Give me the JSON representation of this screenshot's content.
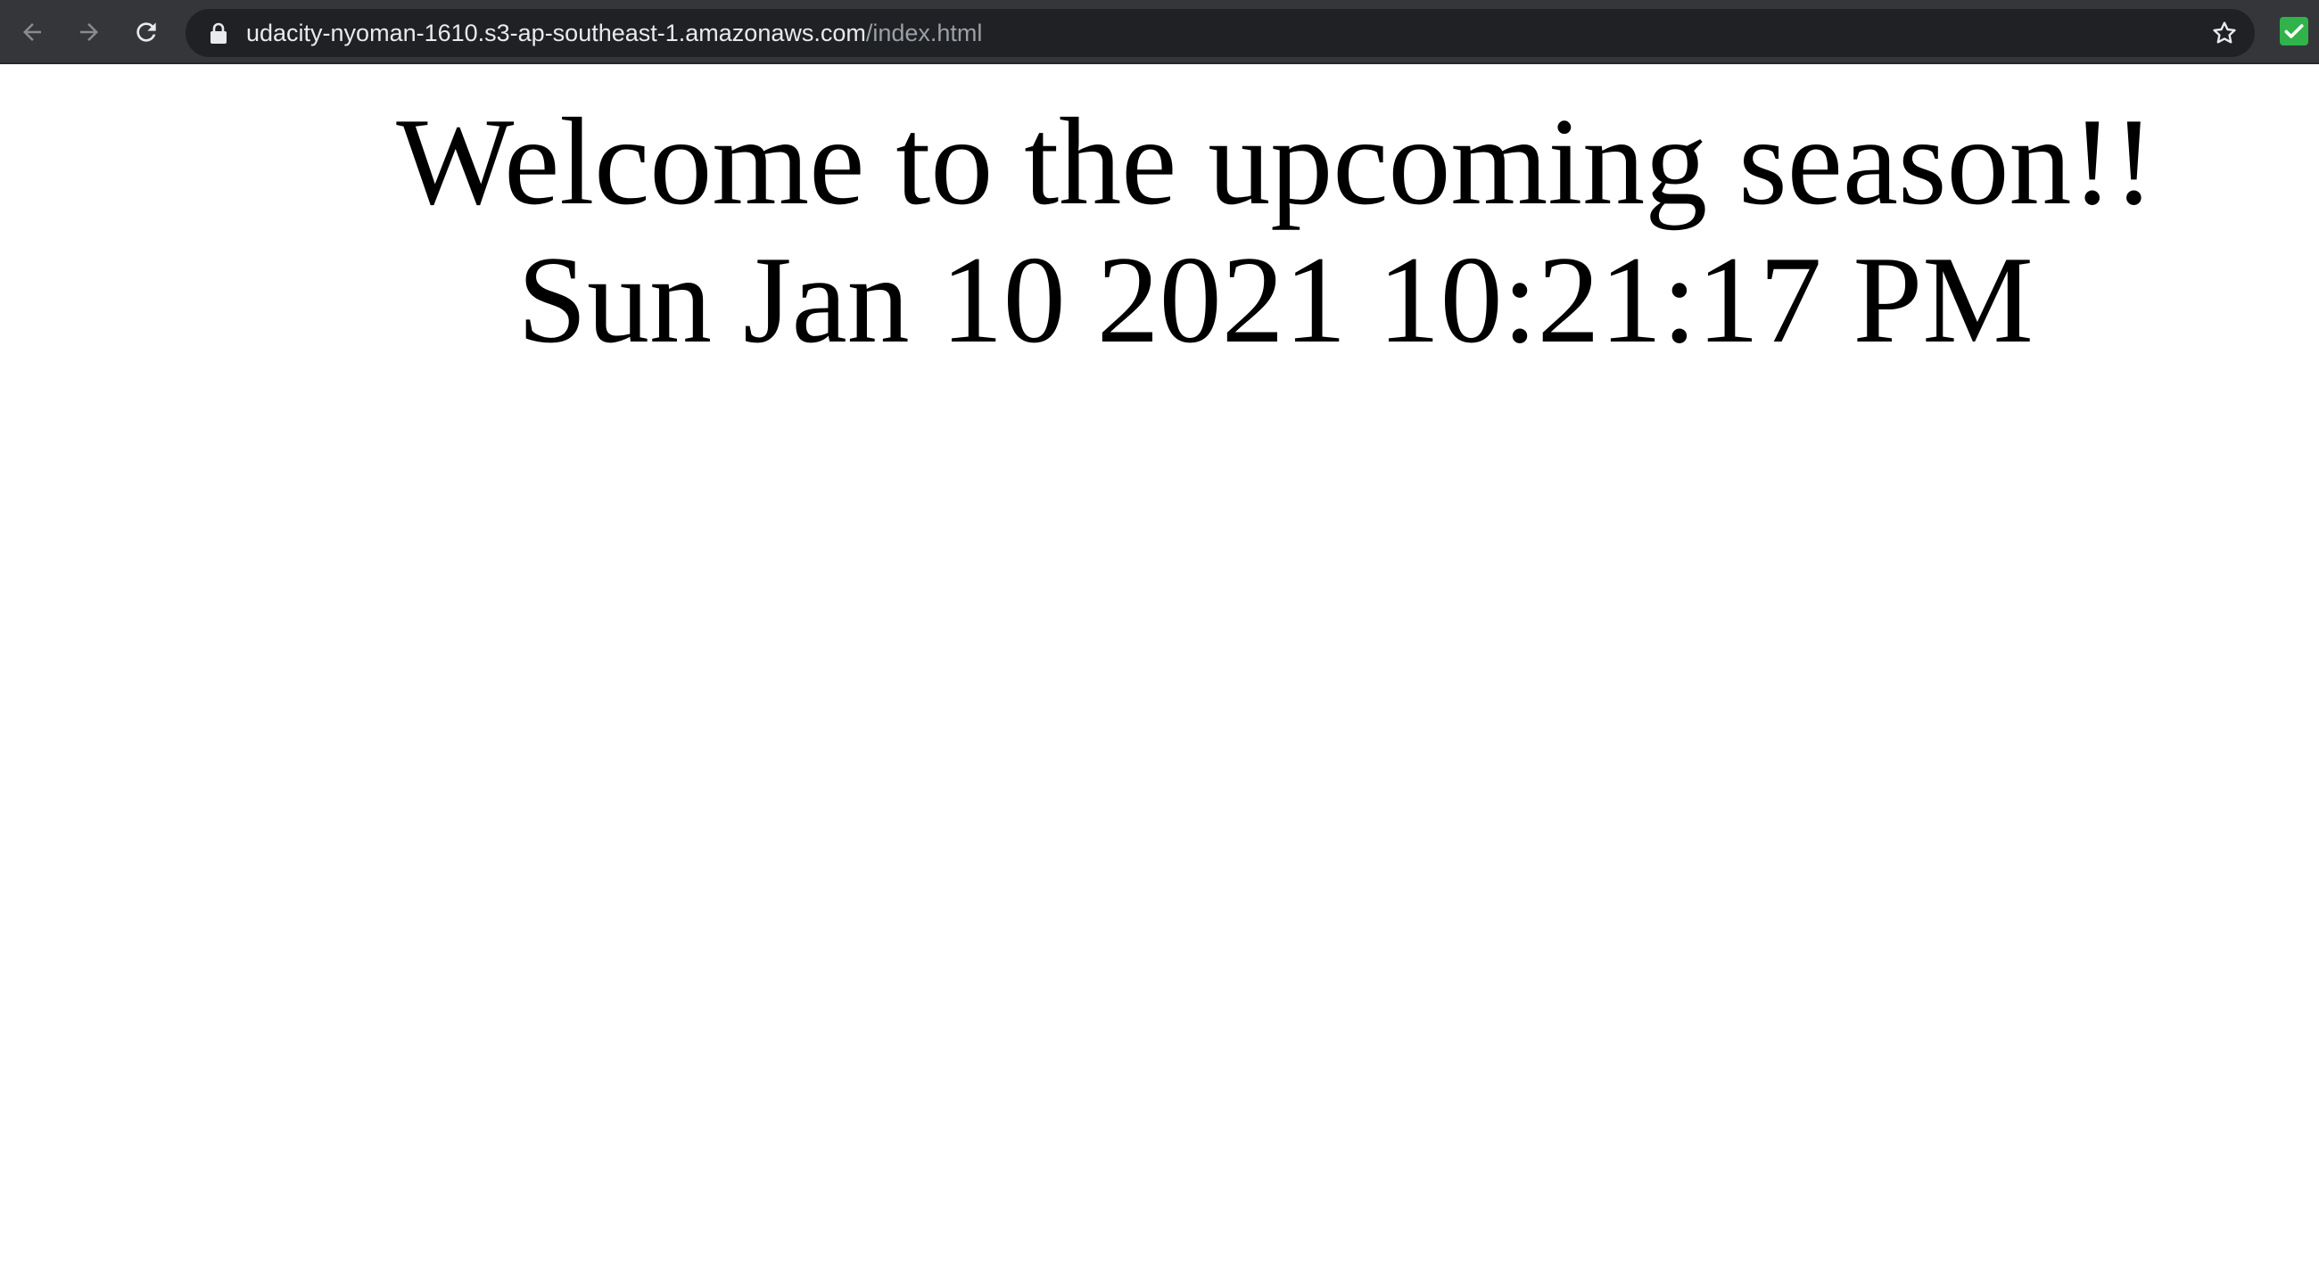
{
  "browser": {
    "url_host": "udacity-nyoman-1610.s3-ap-southeast-1.amazonaws.com",
    "url_path": "/index.html",
    "icons": {
      "back": "arrow-left-icon",
      "forward": "arrow-right-icon",
      "reload": "reload-icon",
      "lock": "lock-icon",
      "bookmark": "star-icon",
      "extension": "checkmark-extension-icon"
    },
    "colors": {
      "toolbar": "#35363a",
      "omnibox": "#202124",
      "url_text": "#e8eaed",
      "url_path": "#9aa0a6",
      "extension": "#2fb34a"
    }
  },
  "page": {
    "heading": "Welcome to the upcoming season!!",
    "datetime": "Sun Jan 10 2021 10:21:17 PM"
  }
}
